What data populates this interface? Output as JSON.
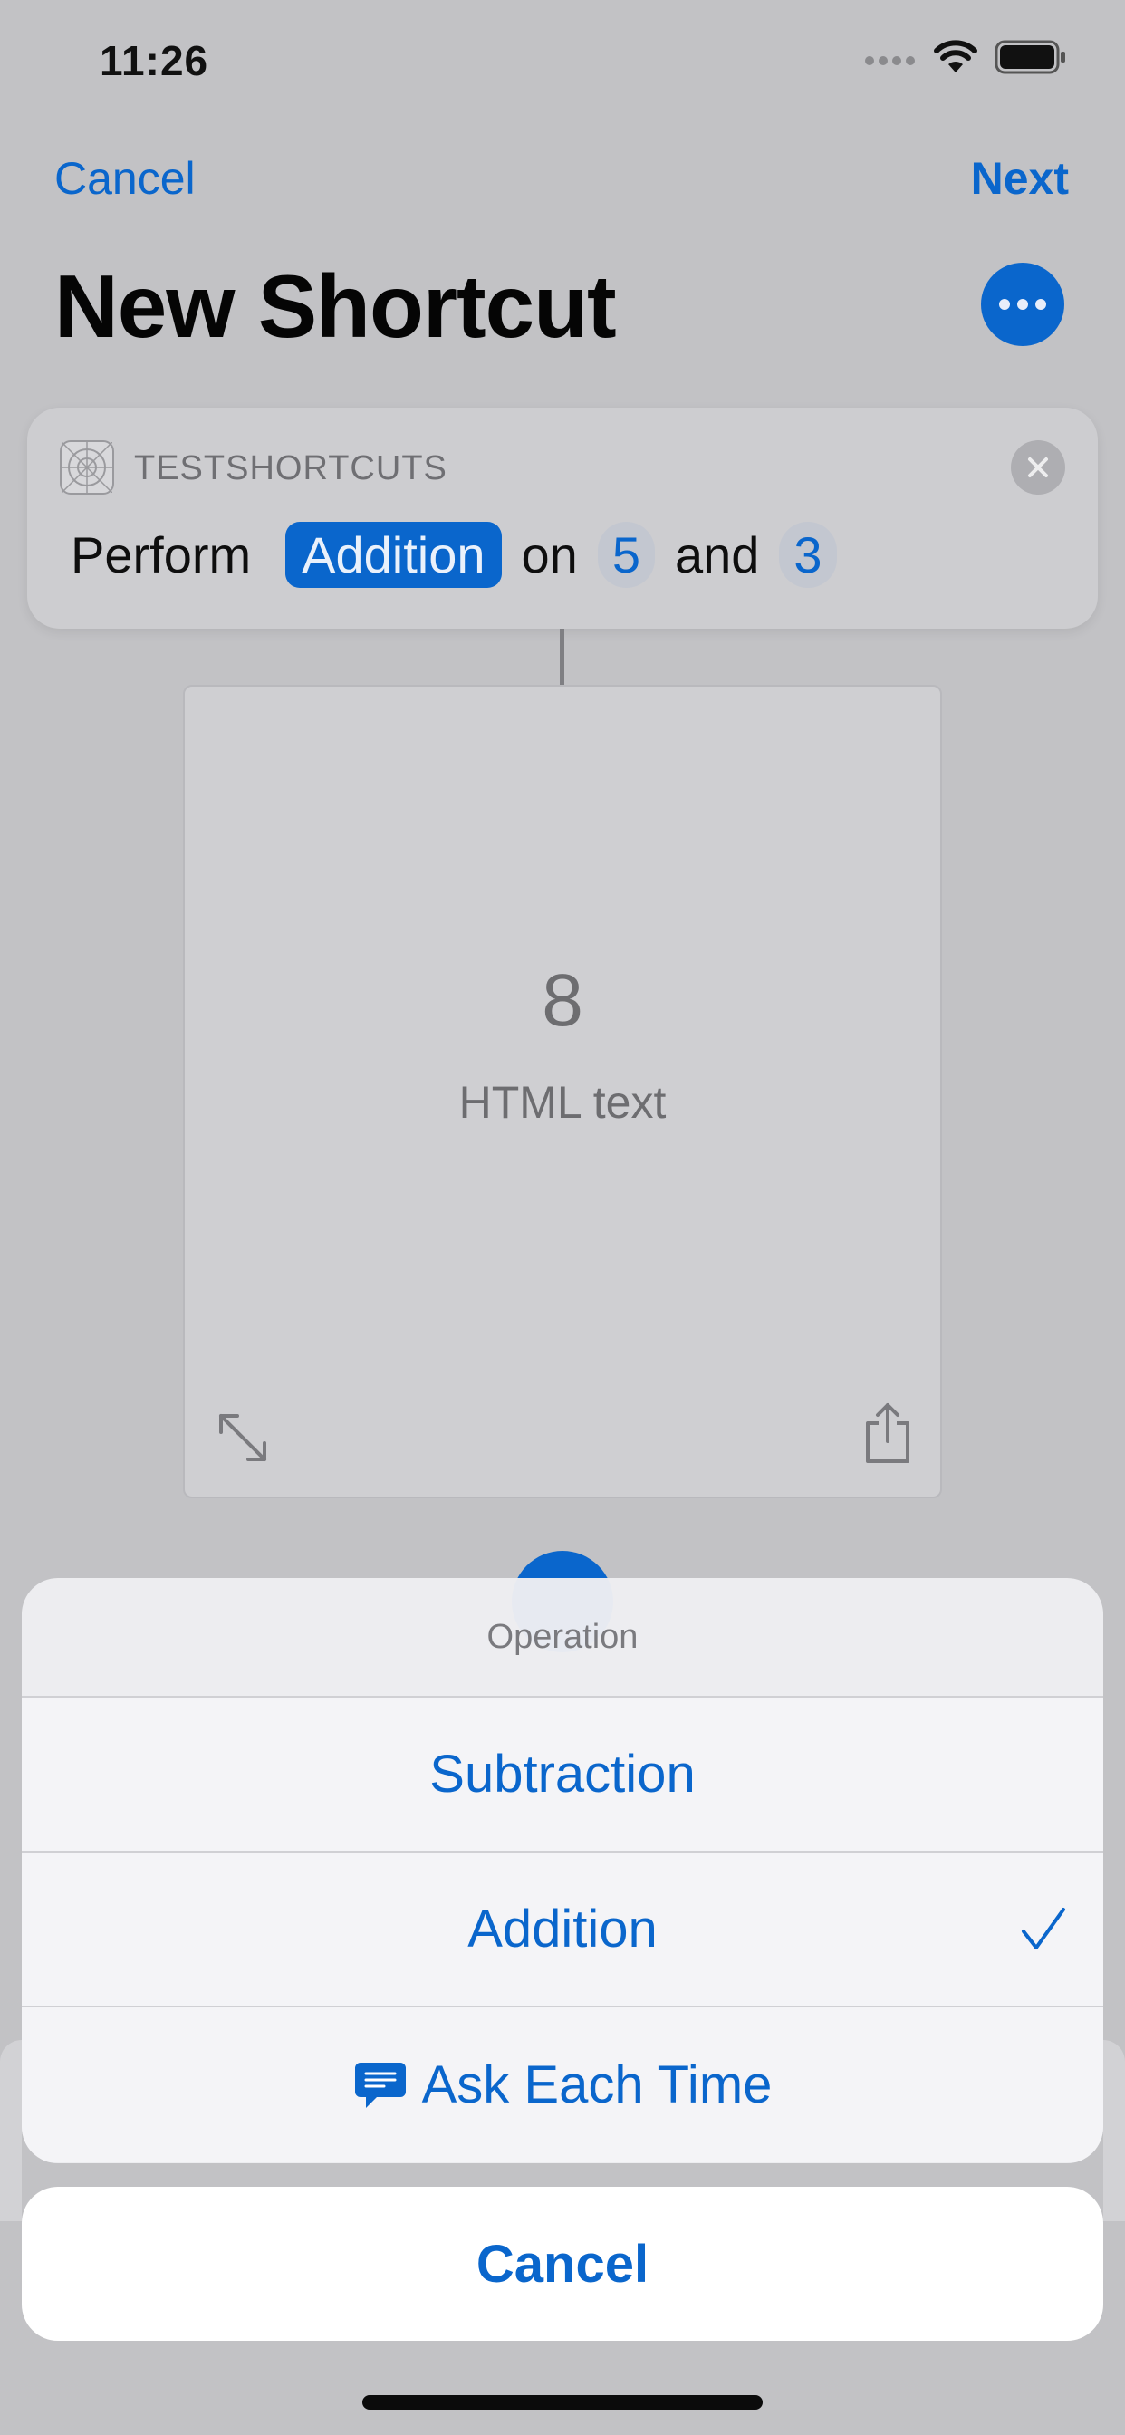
{
  "status_bar": {
    "time": "11:26"
  },
  "nav": {
    "cancel_label": "Cancel",
    "next_label": "Next"
  },
  "page": {
    "title": "New Shortcut"
  },
  "action": {
    "app_name": "TESTSHORTCUTS",
    "verb": "Perform",
    "operation": "Addition",
    "word_on": "on",
    "operand_a": "5",
    "word_and": "and",
    "operand_b": "3"
  },
  "result": {
    "value": "8",
    "type": "HTML text"
  },
  "sheet": {
    "title": "Operation",
    "options": [
      {
        "label": "Subtraction",
        "selected": false
      },
      {
        "label": "Addition",
        "selected": true
      },
      {
        "label": "Ask Each Time",
        "selected": false
      }
    ],
    "cancel_label": "Cancel"
  },
  "colors": {
    "accent": "#0a66cc",
    "dimmed_background": "#c2c2c5"
  }
}
